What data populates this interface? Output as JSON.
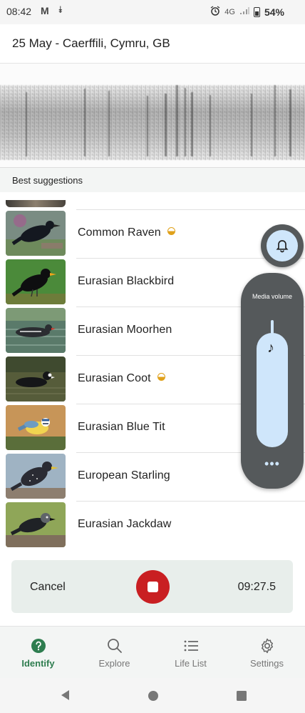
{
  "status_bar": {
    "time": "08:42",
    "gmail_glyph": "M",
    "download_glyph": "⯯",
    "network": "4G",
    "battery": "54%"
  },
  "header": {
    "title": "25 May - Caerffili, Cymru, GB"
  },
  "section": {
    "label": "Best suggestions"
  },
  "suggestions": [
    {
      "name": "Common Raven",
      "uncertain": true,
      "thumb_icon": "raven-photo"
    },
    {
      "name": "Eurasian Blackbird",
      "uncertain": false,
      "thumb_icon": "blackbird-photo"
    },
    {
      "name": "Eurasian Moorhen",
      "uncertain": false,
      "thumb_icon": "moorhen-photo"
    },
    {
      "name": "Eurasian Coot",
      "uncertain": true,
      "thumb_icon": "coot-photo"
    },
    {
      "name": "Eurasian Blue Tit",
      "uncertain": false,
      "thumb_icon": "blue-tit-photo"
    },
    {
      "name": "European Starling",
      "uncertain": false,
      "thumb_icon": "starling-photo"
    },
    {
      "name": "Eurasian Jackdaw",
      "uncertain": false,
      "thumb_icon": "jackdaw-photo"
    }
  ],
  "volume_panel": {
    "label": "Media volume",
    "level": 0.85,
    "more_glyph": "•••"
  },
  "recording": {
    "cancel_label": "Cancel",
    "timer": "09:27.5"
  },
  "bottom_nav": [
    {
      "label": "Identify",
      "icon": "question-icon",
      "active": true
    },
    {
      "label": "Explore",
      "icon": "search-icon",
      "active": false
    },
    {
      "label": "Life List",
      "icon": "list-icon",
      "active": false
    },
    {
      "label": "Settings",
      "icon": "gear-icon",
      "active": false
    }
  ],
  "colors": {
    "accent_green": "#2e7d4f",
    "record_red": "#c91f22",
    "volume_panel": "#55595b",
    "volume_fill": "#cfe6fb",
    "uncertain_badge": "#e0a11b"
  }
}
